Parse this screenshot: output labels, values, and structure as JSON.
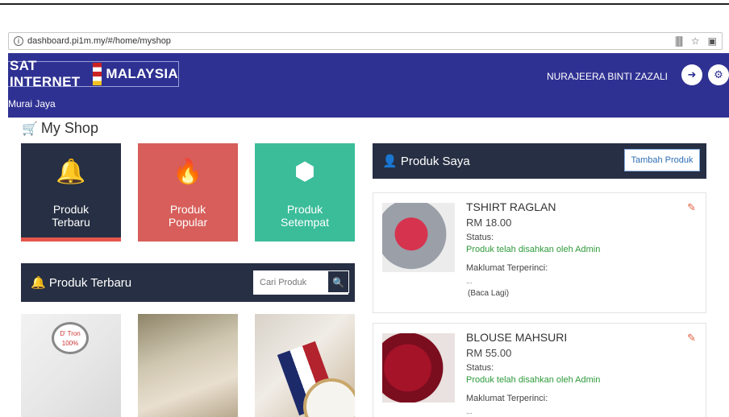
{
  "browser": {
    "url": "dashboard.pi1m.my/#/home/myshop",
    "info_icon": "info-icon",
    "bookmark_icon": "star-icon"
  },
  "header": {
    "logo_left": "SAT INTERNET",
    "logo_right": "MALAYSIA",
    "location": "Murai Jaya",
    "user_name": "NURAJEERA BINTI ZAZALI",
    "accent_color": "#2f3192"
  },
  "shop": {
    "title": "My Shop"
  },
  "tiles": [
    {
      "label_line1": "Produk",
      "label_line2": "Terbaru",
      "icon": "bell-icon",
      "color": "#262f43"
    },
    {
      "label_line1": "Produk",
      "label_line2": "Popular",
      "icon": "fire-icon",
      "color": "#d75e5a"
    },
    {
      "label_line1": "Produk",
      "label_line2": "Setempat",
      "icon": "cubes-icon",
      "color": "#3bbd9a"
    }
  ],
  "latest": {
    "title": "Produk Terbaru",
    "search_placeholder": "Cari Produk"
  },
  "my_products": {
    "title": "Produk Saya",
    "add_button": "Tambah Produk",
    "items": [
      {
        "name": "TSHIRT RAGLAN",
        "price": "RM 18.00",
        "status_label": "Status:",
        "status_value": "Produk telah disahkan oleh Admin",
        "details_label": "Maklumat Terperinci:",
        "details_text": "...",
        "read_more": "(Baca Lagi)"
      },
      {
        "name": "BLOUSE MAHSURI",
        "price": "RM 55.00",
        "status_label": "Status:",
        "status_value": "Produk telah disahkan oleh Admin",
        "details_label": "Maklumat Terperinci:",
        "details_text": "..."
      }
    ]
  },
  "status_color": "#2e9a3a"
}
